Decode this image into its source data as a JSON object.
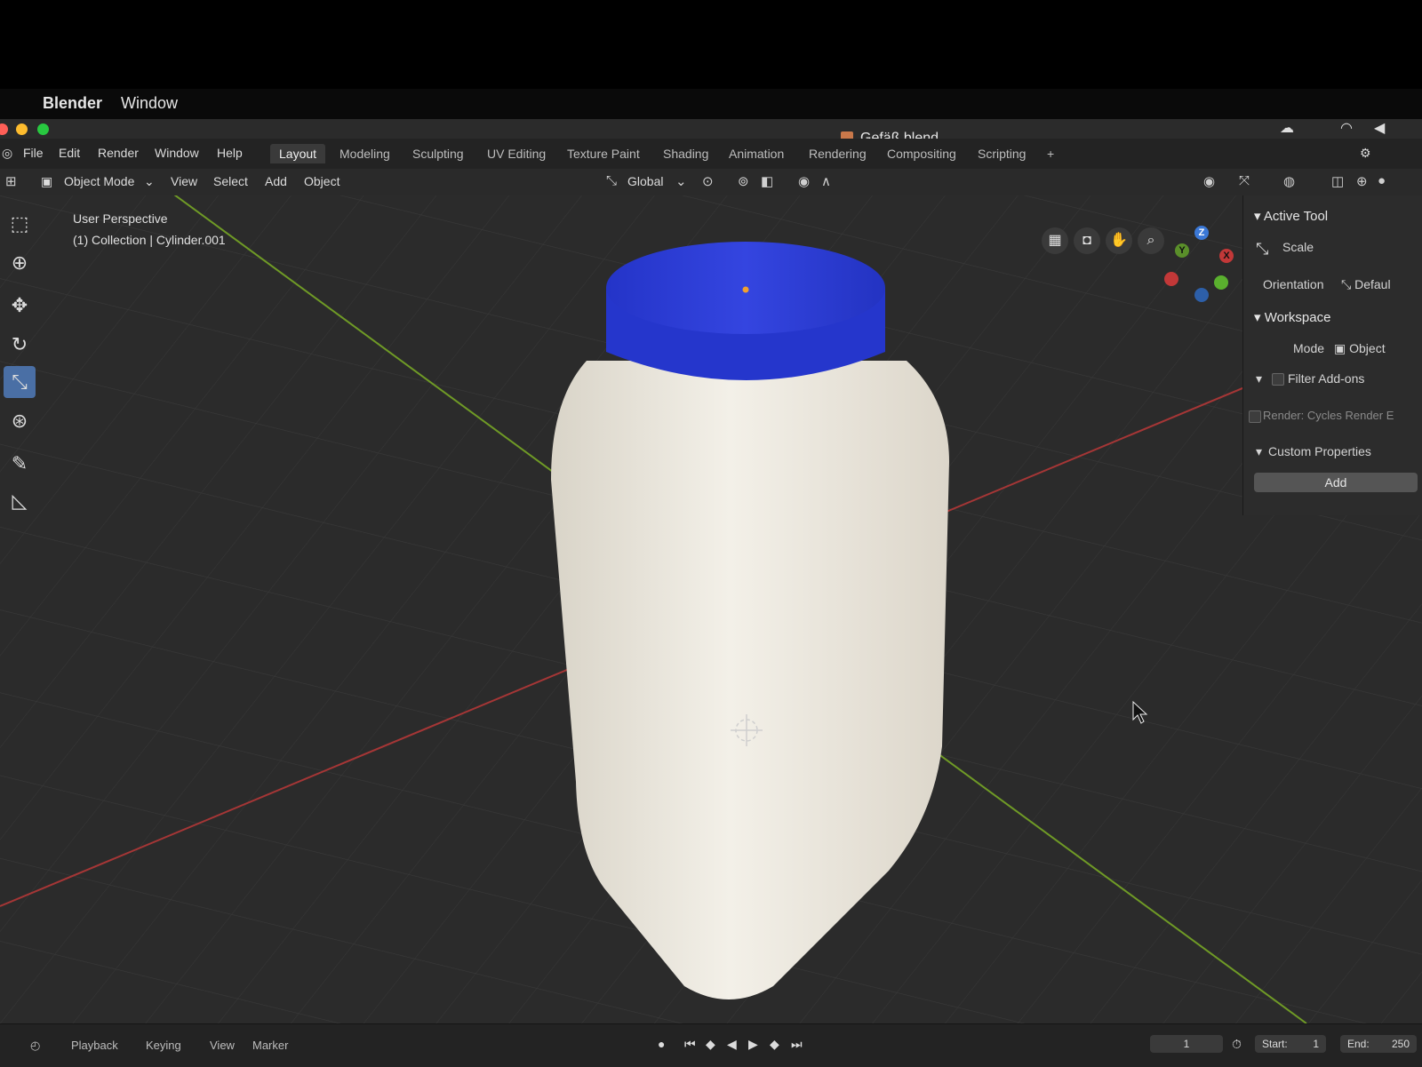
{
  "mac_menubar": {
    "apple_icon": "apple-logo-icon",
    "app_name": "Blender",
    "menu_window": "Window"
  },
  "window": {
    "title": "Gefäß.blend"
  },
  "menus": [
    "File",
    "Edit",
    "Render",
    "Window",
    "Help"
  ],
  "workspace_tabs": [
    "Layout",
    "Modeling",
    "Sculpting",
    "UV Editing",
    "Texture Paint",
    "Shading",
    "Animation",
    "Rendering",
    "Compositing",
    "Scripting"
  ],
  "active_tab": "Layout",
  "add_tab_icon": "plus-icon",
  "header": {
    "mode": "Object Mode",
    "view": "View",
    "select": "Select",
    "add": "Add",
    "object": "Object",
    "orientation": "Global"
  },
  "viewport": {
    "perspective": "User Perspective",
    "collection": "(1) Collection | Cylinder.001",
    "gizmo": {
      "x": "X",
      "y": "Y",
      "z": "Z"
    },
    "colors": {
      "lid": "#2f3fd6",
      "jar": "#ece8df",
      "x_axis": "#b33a3a",
      "y_axis": "#7aa02e"
    }
  },
  "npanel": {
    "active_tool_header": "Active Tool",
    "tool_name": "Scale",
    "orientation_label": "Orientation",
    "orientation_value": "Defaul",
    "workspace_header": "Workspace",
    "mode_label": "Mode",
    "mode_value": "Object",
    "filter_addons": "Filter Add-ons",
    "render_addon": "Render: Cycles Render E",
    "custom_properties": "Custom Properties",
    "add_button": "Add"
  },
  "timeline": {
    "playback": "Playback",
    "keying": "Keying",
    "view": "View",
    "marker": "Marker",
    "current_frame": "1",
    "start_label": "Start:",
    "start_value": "1",
    "end_label": "End:",
    "end_value": "250"
  }
}
